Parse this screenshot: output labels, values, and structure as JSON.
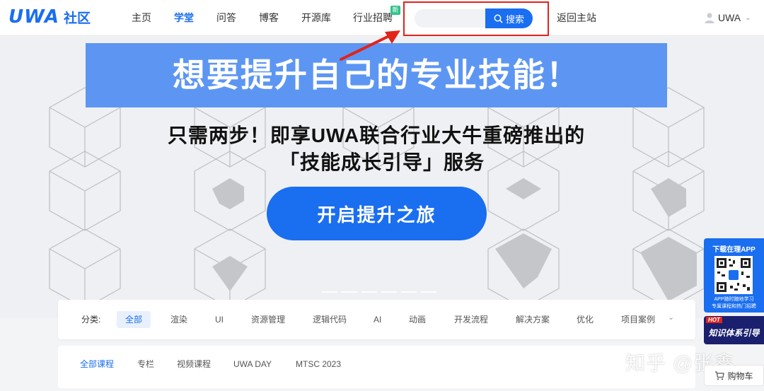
{
  "brand": {
    "logo": "UWA",
    "sub": "社区",
    "accent": "#1a6ef0"
  },
  "nav": {
    "items": [
      {
        "label": "主页"
      },
      {
        "label": "学堂"
      },
      {
        "label": "问答"
      },
      {
        "label": "博客"
      },
      {
        "label": "开源库"
      },
      {
        "label": "行业招聘"
      }
    ],
    "active": "学堂",
    "new_badge": "新",
    "back_label": "返回主站"
  },
  "search": {
    "placeholder": "",
    "button_label": "搜索",
    "highlight_color": "#e2231a"
  },
  "user": {
    "name": "UWA"
  },
  "banner": {
    "title": "想要提升自己的专业技能！",
    "line1": "只需两步！即享UWA联合行业大牛重磅推出的",
    "line2": "「技能成长引导」服务",
    "cta": "开启提升之旅"
  },
  "side": {
    "app_title": "下载在理APP",
    "qr_caption1": "APP随时随地学习",
    "qr_caption2": "专属课程和热门招聘",
    "hot_tag": "HOT",
    "hot_label": "知识体系引导",
    "cart_label": "购物车"
  },
  "filter": {
    "label": "分类:",
    "items": [
      "全部",
      "渲染",
      "UI",
      "资源管理",
      "逻辑代码",
      "AI",
      "动画",
      "开发流程",
      "解决方案",
      "优化",
      "项目案例"
    ],
    "active": "全部"
  },
  "tabs": {
    "items": [
      "全部课程",
      "专栏",
      "视频课程",
      "UWA DAY",
      "MTSC 2023"
    ],
    "active": "全部课程"
  },
  "watermark": "知乎 @张鑫"
}
